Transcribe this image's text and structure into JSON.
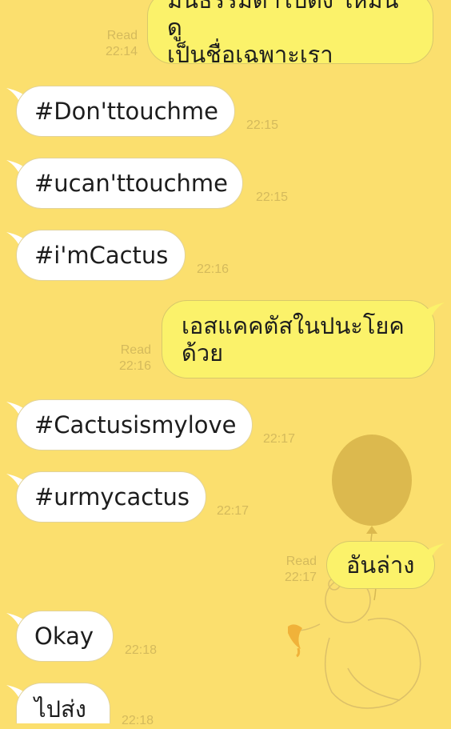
{
  "background": {
    "color": "#fbdf6e",
    "art": "winnie-the-pooh-with-balloon"
  },
  "messages": [
    {
      "dir": "out",
      "lines": [
        "มันธรรมดาไปตึ้ง ให้มันดู",
        "เป็นชื่อเฉพาะเรา"
      ],
      "read": "Read",
      "time": "22:14"
    },
    {
      "dir": "in",
      "text": "#Don'ttouchme",
      "time": "22:15"
    },
    {
      "dir": "in",
      "text": "#ucan'ttouchme",
      "time": "22:15"
    },
    {
      "dir": "in",
      "text": "#i'mCactus",
      "time": "22:16"
    },
    {
      "dir": "out",
      "lines": [
        "เอสแคคตัสในปนะโยค",
        "ด้วย"
      ],
      "read": "Read",
      "time": "22:16"
    },
    {
      "dir": "in",
      "text": "#Cactusismylove",
      "time": "22:17"
    },
    {
      "dir": "in",
      "text": "#urmycactus",
      "time": "22:17"
    },
    {
      "dir": "out",
      "lines": [
        "อันล่าง"
      ],
      "read": "Read",
      "time": "22:17"
    },
    {
      "dir": "in",
      "text": "Okay",
      "time": "22:18"
    },
    {
      "dir": "in",
      "text": "ไปส่ง",
      "time": "22:18"
    }
  ]
}
